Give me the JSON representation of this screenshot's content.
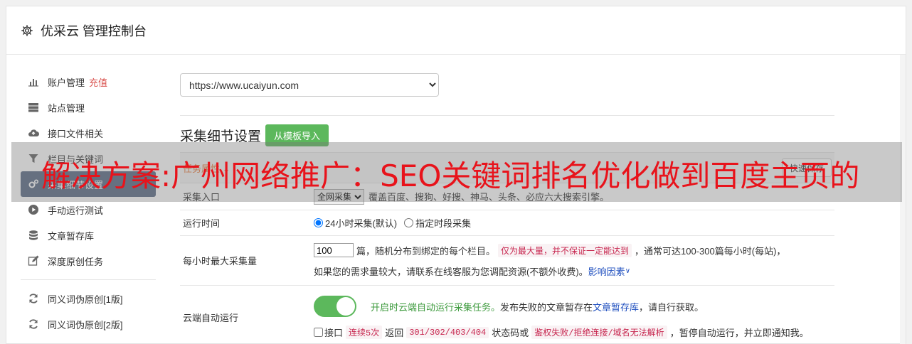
{
  "header": {
    "title": "优采云 管理控制台",
    "icon": "gear-icon"
  },
  "sidebar": {
    "items": [
      {
        "label": "账户管理",
        "badge": "充值",
        "icon": "bar-chart-icon"
      },
      {
        "label": "站点管理",
        "icon": "server-icon"
      },
      {
        "label": "接口文件相关",
        "icon": "cloud-upload-icon"
      },
      {
        "label": "栏目与关键词",
        "icon": "filter-icon"
      },
      {
        "label": "采集细节设置",
        "icon": "gears-icon",
        "active": true
      },
      {
        "label": "手动运行测试",
        "icon": "play-circle-icon"
      },
      {
        "label": "文章暂存库",
        "icon": "database-icon"
      },
      {
        "label": "深度原创任务",
        "icon": "edit-icon"
      },
      {
        "label": "同义词伪原创[1版]",
        "icon": "refresh-icon"
      },
      {
        "label": "同义词伪原创[2版]",
        "icon": "refresh-icon"
      }
    ]
  },
  "main": {
    "site_select": {
      "value": "https://www.ucaiyun.com"
    },
    "section_title": "采集细节设置",
    "import_button": "从模板导入",
    "tab_label": "任务属性 ⌄",
    "quick_save": "快速保存",
    "rows": {
      "entry": {
        "label": "采集入口",
        "select_value": "全网采集",
        "desc": "覆盖百度、搜狗、好搜、神马、头条、必应六大搜索引擎。"
      },
      "runtime": {
        "label": "运行时间",
        "opt1": "24小时采集(默认)",
        "opt2": "指定时段采集"
      },
      "max_per_hour": {
        "label": "每小时最大采集量",
        "value": "100",
        "text1": "篇，随机分布到绑定的每个栏目。",
        "code1": "仅为最大量，并不保证一定能达到",
        "text2": "，通常可达100-300篇每小时(每站)，",
        "text3": "如果您的需求量较大，请联系在线客服为您调配资源(不额外收费)。",
        "link": "影响因素"
      },
      "cloud_run": {
        "label": "云端自动运行",
        "green_text": "开启时云端自动运行采集任务。",
        "text1": "发布失败的文章暂存在",
        "link": "文章暂存库",
        "text2": "，请自行获取。",
        "checkbox_label": "接口",
        "code1": "连续5次",
        "text3": "返回",
        "code2": "301/302/403/404",
        "text4": "状态码或",
        "code3": "鉴权失败/拒绝连接/域名无法解析",
        "text5": "，暂停自动运行，并立即通知我。"
      }
    }
  },
  "banner": {
    "text": "解决方案:广州网络推广：SEO关键词排名优化做到百度主页的"
  }
}
